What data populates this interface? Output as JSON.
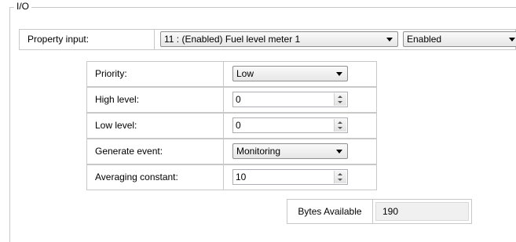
{
  "group": {
    "title": "I/O"
  },
  "property_input": {
    "label": "Property input:",
    "selected": "11 : (Enabled) Fuel level meter 1",
    "state": "Enabled"
  },
  "params": {
    "priority": {
      "label": "Priority:",
      "value": "Low"
    },
    "high_level": {
      "label": "High level:",
      "value": "0"
    },
    "low_level": {
      "label": "Low level:",
      "value": "0"
    },
    "generate_event": {
      "label": "Generate event:",
      "value": "Monitoring"
    },
    "averaging_constant": {
      "label": "Averaging constant:",
      "value": "10"
    }
  },
  "bytes": {
    "label": "Bytes Available",
    "value": "190"
  }
}
